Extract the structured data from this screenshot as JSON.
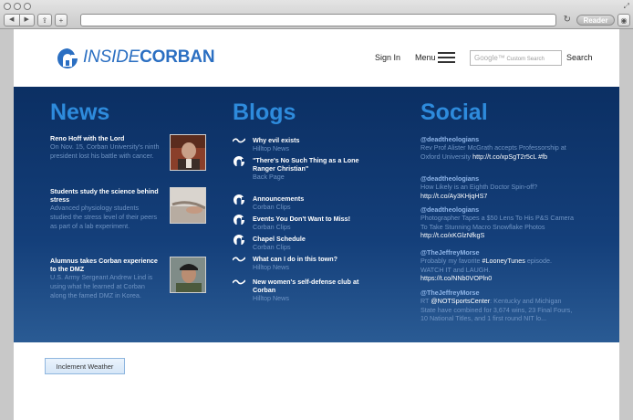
{
  "browser": {
    "reader_label": "Reader",
    "new_tab_label": "+"
  },
  "site": {
    "logo_part1": "INSIDE",
    "logo_part2": "CORBAN",
    "sign_in": "Sign In",
    "menu": "Menu",
    "search_placeholder": "Custom Search",
    "search_brand": "Google™",
    "search_button": "Search"
  },
  "news": {
    "heading": "News",
    "items": [
      {
        "title": "Reno Hoff with the Lord",
        "desc": "On Nov. 15, Corban University's ninth president lost his battle with cancer."
      },
      {
        "title": "Students study the science behind stress",
        "desc": "Advanced physiology students studied the stress level of their peers as part of a lab experiment."
      },
      {
        "title": "Alumnus takes Corban experience to the DMZ",
        "desc": "U.S. Army Sergeant Andrew Lind is using what he learned at Corban along the famed DMZ in Korea."
      }
    ]
  },
  "blogs": {
    "heading": "Blogs",
    "items": [
      {
        "title": "Why evil exists",
        "source": "Hilltop News",
        "icon": "wave-icon"
      },
      {
        "title": "\"There's No Such Thing as a Lone Ranger Christian\"",
        "source": "Back Page",
        "icon": "corban-c-icon"
      },
      {
        "title": "Announcements",
        "source": "Corban Clips",
        "icon": "corban-c-icon"
      },
      {
        "title": "Events You Don't Want to Miss!",
        "source": "Corban Clips",
        "icon": "corban-c-icon"
      },
      {
        "title": "Chapel Schedule",
        "source": "Corban Clips",
        "icon": "corban-c-icon"
      },
      {
        "title": "What can I do in this town?",
        "source": "Hilltop News",
        "icon": "wave-icon"
      },
      {
        "title": "New women's self-defense club at Corban",
        "source": "Hilltop News",
        "icon": "wave-icon"
      }
    ]
  },
  "social": {
    "heading": "Social",
    "items": [
      {
        "handle": "@deadtheologians",
        "text": "Rev Prof Alister McGrath accepts Professorship at Oxford University",
        "link": "http://t.co/xpSgT2r5cL #fb"
      },
      {
        "handle": "@deadtheologians",
        "text": "How Likely is an Eighth Doctor Spin-off?",
        "link": "http://t.co/Ay3KHjqHS7"
      },
      {
        "handle": "@deadtheologians",
        "text": "Photographer Tapes a $50 Lens To His P&S Camera To Take Stunning Macro Snowflake Photos",
        "link": "http://t.co/xKGlzNfkgS"
      },
      {
        "handle": "@TheJeffreyMorse",
        "text": "Probably my favorite",
        "hashtag": "#LooneyTunes",
        "text2": "episode. WATCH IT and LAUGH.",
        "link": "https://t.co/NNb0VOPln0"
      },
      {
        "handle": "@TheJeffreyMorse",
        "text": "RT",
        "mention": "@NOTSportsCenter",
        "text2": ": Kentucky and Michigan State have combined for 3,674 wins, 23 Final Fours, 10 National Titles, and 1 first round NIT lo..."
      }
    ]
  },
  "footer": {
    "weather_button": "Inclement Weather"
  },
  "colors": {
    "brand_blue": "#2b6fc2",
    "hero_dark": "#0b2f63",
    "heading_blue": "#2e8bdc"
  }
}
